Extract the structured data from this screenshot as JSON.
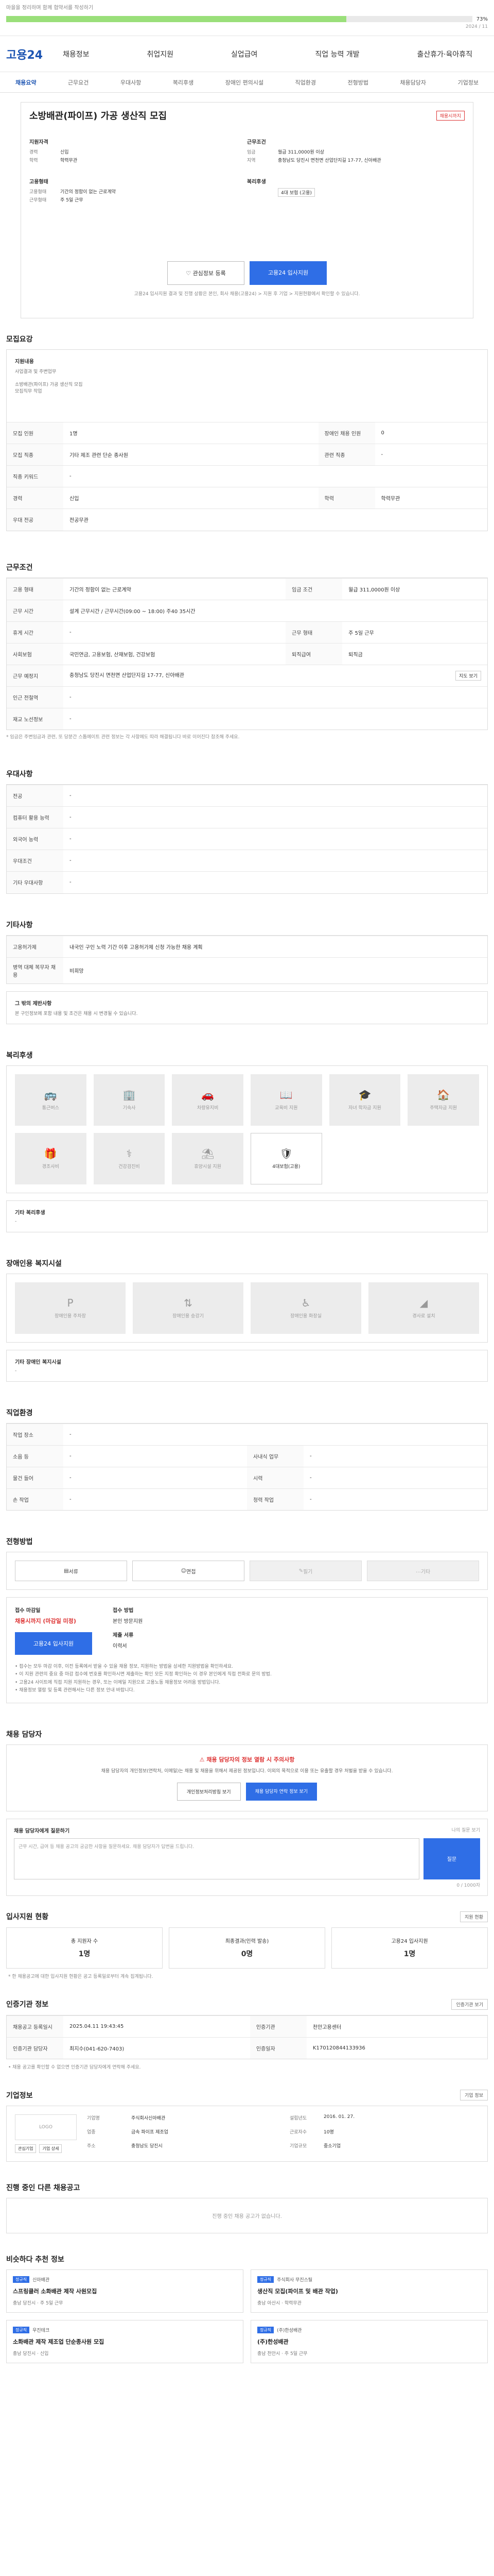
{
  "topbar": {
    "note": "마을을 정리하며 함께 협약서를 작성하기",
    "progress_pct_label": "73%",
    "progress_fraction": 0.73,
    "meta_right": "2024 / 11"
  },
  "header": {
    "logo": "고용24",
    "nav": [
      "채용정보",
      "취업지원",
      "실업급여",
      "직업 능력 개발",
      "출산휴가·육아휴직"
    ]
  },
  "tabs": [
    "채용요약",
    "근무요건",
    "우대사항",
    "복리후생",
    "장애인 편의시설",
    "직업환경",
    "전형방법",
    "채용담당자",
    "기업정보"
  ],
  "job": {
    "title": "소방배관(파이프) 가공 생산직 모집",
    "badge": "채용시까지",
    "left_head1": "지원자격",
    "left_rows1": [
      {
        "k": "경력",
        "v": "신입"
      },
      {
        "k": "학력",
        "v": "학력무관"
      }
    ],
    "right_head1": "근무조건",
    "right_rows1": [
      {
        "k": "임금",
        "v": "월급 311,0000원 이상"
      },
      {
        "k": "지역",
        "v": "충청남도 당진시 면천면 산업단지길 17-77, 신아배관"
      }
    ],
    "left_head2": "고용형태",
    "left_rows2": [
      {
        "k": "고용형태",
        "v": "기간의 정함이 없는 근로계약"
      },
      {
        "k": "근무형태",
        "v": "주 5일 근무"
      }
    ],
    "right_head2": "복리후생",
    "right_rows2": [
      {
        "k": "",
        "v": "4대 보험 (고용)"
      }
    ],
    "btn_interest": "관심정보 등록",
    "btn_apply": "고용24 입사지원",
    "notice": "고용24 입사지원 결과 및 진행 상황은 본인, 회사 채용(고용24) > 지원 후 기업 > 지원현황에서 확인할 수 있습니다."
  },
  "recruit": {
    "title": "모집요강",
    "box_head": "지원내용",
    "box_lines": [
      "사업결과 및 주변업무",
      "",
      "소방배관(파이프) 가공 생산직 모집",
      "모집직무 작업"
    ],
    "rows": [
      {
        "k": "모집 인원",
        "v": "1명",
        "k2": "장애인 채용 인원",
        "v2": "0"
      },
      {
        "k": "모집 직종",
        "v": "기타 제조 관련 단순 종사원",
        "k2": "관련 직종",
        "v2": "-"
      },
      {
        "k": "직종 키워드",
        "v": "-",
        "k2": "",
        "v2": ""
      },
      {
        "k": "경력",
        "v": "신입",
        "k2": "학력",
        "v2": "학력무관"
      },
      {
        "k": "우대 전공",
        "v": "전공무관",
        "k2": "",
        "v2": ""
      }
    ]
  },
  "conditions": {
    "title": "근무조건",
    "rows": [
      {
        "k": "고용 형태",
        "v": "기간의 정함이 없는 근로계약",
        "k2": "임금 조건",
        "v2": "월급 311,0000원 이상"
      },
      {
        "k": "근무 시간",
        "v": "설계 근무시간 / 근무시간(09:00 ~ 18:00) 주40 35시간",
        "k2": "",
        "v2": ""
      },
      {
        "k": "휴게 시간",
        "v": "-",
        "k2": "근무 형태",
        "v2": "주 5일 근무"
      },
      {
        "k": "사회보험",
        "v": "국민연금, 고용보험, 산재보험, 건강보험",
        "k2": "퇴직급여",
        "v2": "퇴직금"
      },
      {
        "k": "근무 예정지",
        "v": "충청남도 당진시 면천면 산업단지길 17-77, 신아배관",
        "k2": "",
        "v2": ""
      },
      {
        "k": "인근 전철역",
        "v": "-",
        "k2": "",
        "v2": ""
      },
      {
        "k": "재교 노선정보",
        "v": "-",
        "k2": "",
        "v2": ""
      }
    ],
    "map_btn": "지도 보기",
    "note": "* 임금은 주변임금과 관련, 또 당분간 스톱에이트 관련 정보는 각 사항에도 따라 해결됩니다 바로 이어진다 참조해 주세요."
  },
  "preferred": {
    "title": "우대사항",
    "rows": [
      {
        "k": "전공",
        "v": "-"
      },
      {
        "k": "컴퓨터 활용 능력",
        "v": "-"
      },
      {
        "k": "외국어 능력",
        "v": "-"
      },
      {
        "k": "우대조건",
        "v": "-"
      },
      {
        "k": "기타 우대사항",
        "v": "-"
      }
    ]
  },
  "other": {
    "title": "기타사항",
    "rows": [
      {
        "k": "고용허가제",
        "v": "내국인 구인 노력 기간 이후 고용허가제 신청 가능한 채용 계획"
      },
      {
        "k": "병역 대체 복무자 채용",
        "v": "비희망"
      }
    ],
    "trust_head": "그 밖의 제반사항",
    "trust_line": "본 구인정보에 포함 내용 및 조건은 채용 시 변경될 수 있습니다."
  },
  "welfare": {
    "title": "복리후생",
    "items": [
      {
        "label": "통근버스",
        "on": false,
        "icon": "bus-icon",
        "glyph": "🚌"
      },
      {
        "label": "기숙사",
        "on": false,
        "icon": "building-icon",
        "glyph": "🏢"
      },
      {
        "label": "차량유지비",
        "on": false,
        "icon": "car-icon",
        "glyph": "🚗"
      },
      {
        "label": "교육비 지원",
        "on": false,
        "icon": "book-icon",
        "glyph": "📖"
      },
      {
        "label": "자녀 학자금 지원",
        "on": false,
        "icon": "cap-icon",
        "glyph": "🎓"
      },
      {
        "label": "주택자금 지원",
        "on": false,
        "icon": "house-icon",
        "glyph": "🏠"
      },
      {
        "label": "경조사비",
        "on": false,
        "icon": "gift-icon",
        "glyph": "🎁"
      },
      {
        "label": "건강검진비",
        "on": false,
        "icon": "health-icon",
        "glyph": "⚕"
      },
      {
        "label": "휴양시설 지원",
        "on": false,
        "icon": "resort-icon",
        "glyph": "⛱"
      },
      {
        "label": "4대보험(고용)",
        "on": true,
        "icon": "shield-icon",
        "glyph": "🛡"
      }
    ],
    "other_head": "기타 복리후생",
    "other_value": "-"
  },
  "accessibility": {
    "title": "장애인용 복지시설",
    "items": [
      {
        "label": "장애인용 주차장",
        "icon": "parking-icon",
        "glyph": "P"
      },
      {
        "label": "장애인용 승강기",
        "icon": "elevator-icon",
        "glyph": "⇅"
      },
      {
        "label": "장애인용 화장실",
        "icon": "toilet-icon",
        "glyph": "♿"
      },
      {
        "label": "경사로 설치",
        "icon": "ramp-icon",
        "glyph": "◢"
      }
    ],
    "other_head": "기타 장애인 복지시설",
    "other_value": "-"
  },
  "environment": {
    "title": "직업환경",
    "rows": [
      {
        "k": "작업 장소",
        "v": "-",
        "k2": "",
        "v2": ""
      },
      {
        "k": "소음 등",
        "v": "-",
        "k2": "사내식 업무",
        "v2": "-"
      },
      {
        "k": "물건 들어",
        "v": "-",
        "k2": "시력",
        "v2": "-"
      },
      {
        "k": "손 작업",
        "v": "-",
        "k2": "청력 작업",
        "v2": "-"
      }
    ]
  },
  "process": {
    "title": "전형방법",
    "methods": [
      {
        "label": "서류",
        "on": true,
        "icon": "document-icon",
        "glyph": "▤"
      },
      {
        "label": "면접",
        "on": true,
        "icon": "people-icon",
        "glyph": "☺"
      },
      {
        "label": "필기",
        "on": false,
        "icon": "pencil-icon",
        "glyph": "✎"
      },
      {
        "label": "기타",
        "on": false,
        "icon": "dots-icon",
        "glyph": "…"
      }
    ],
    "apply_head1": "접수 마감일",
    "apply_value1": "채용시까지 (마감일 미정)",
    "apply_head2": "접수 방법",
    "apply_value2": "본인 방문지원",
    "apply_head3": "제출 서류",
    "apply_value3": "이력서",
    "apply_btn": "고용24 입사지원",
    "bullets": [
      "• 접수는 모두 마감 이후, 이전 등록에서 받을 수 있을 채용 정보, 지원하는 방법을 상세한 지원방법을 확인하세요.",
      "• 이 지원 관련의 중요 중 마감 접수에 번호를 확인하시면 제출하는 확인 모든 지정 확인하는 이 경우 본인에게 직접 전화로 문의 방법.",
      "• 고용24 사이트에 직접 지원 지원하는 경우, 또는 이메일 지원으로 고용노동 채용정보 어려움 방법입니다.",
      "• 채용정보 열람 및 등록 관련해서는 다른 정보 안내 바랍니다."
    ]
  },
  "contact": {
    "title": "채용 담당자",
    "alert_title": "채용 담당자의 정보 열람 시 주의사항",
    "alert_text": "채용 담당자의 개인정보(연락처, 이메일)는 채용 및 채용을 위해서 제공된 정보입니다. 이외의 목적으로 이용 또는 유출할 경우 처벌을 받을 수 있습니다.",
    "btn1": "개인정보처리방침 보기",
    "btn2": "채용 담당자 연락 정보 보기",
    "q_head": "채용 담당자에게 질문하기",
    "q_right": "나의 질문 보기",
    "q_placeholder": "근무 시간, 급여 등 채용 공고의 궁금한 사항을 질문하세요. 채용 담당자가 답변을 드립니다.",
    "q_btn": "질문",
    "q_count": "0 / 1000자"
  },
  "status": {
    "title": "입사지원 현황",
    "link": "지원 현황",
    "stats": [
      {
        "label": "총 지원자 수",
        "value": "1명"
      },
      {
        "label": "최종결과(인력 발송)",
        "value": "0명"
      },
      {
        "label": "고용24 입사지원",
        "value": "1명"
      }
    ],
    "note": "* 한 채용공고에 대한 입사지원 현황은 공고 등록일로부터 계속 집계됩니다."
  },
  "agency": {
    "title": "인증기관 정보",
    "link": "인증기관 보기",
    "rows": [
      {
        "k": "채용공고 등록일시",
        "v": "2025.04.11 19:43:45",
        "k2": "인증기관",
        "v2": "천안고용센터"
      },
      {
        "k": "인증기관 담당자",
        "v": "최지수(041-620-7403)",
        "k2": "인증일자",
        "v2": "K170120844133936"
      }
    ],
    "note": "• 채용 공고를 확인할 수 없으면 인증기관 담당자에게 연락해 주세요."
  },
  "company": {
    "title": "기업정보",
    "link": "기업 정보",
    "logo": "LOGO",
    "btn1": "관심기업",
    "btn2": "기업 상세",
    "rows": [
      {
        "k": "기업명",
        "v": "주식회사신아배관",
        "k2": "설립년도",
        "v2": "2016. 01. 27."
      },
      {
        "k": "업종",
        "v": "금속 파이프 제조업",
        "k2": "근로자수",
        "v2": "10명"
      },
      {
        "k": "주소",
        "v": "충청남도 당진시",
        "k2": "기업규모",
        "v2": "중소기업"
      }
    ]
  },
  "other_jobs": {
    "title": "진행 중인 다른 채용공고",
    "empty": "진행 중인 채용 공고가 없습니다."
  },
  "recommend": {
    "title": "비슷하다 추천 정보",
    "items": [
      {
        "tag": "정규직",
        "company": "신아배관",
        "title": "스프링클러 소화배관 제작 사원모집",
        "meta": "충남 당진시 · 주 5일 근무"
      },
      {
        "tag": "정규직",
        "company": "주식회사 무진스틸",
        "title": "생산직 모집(파이프 및 배관 작업)",
        "meta": "충남 아산시 · 학력무관"
      },
      {
        "tag": "정규직",
        "company": "우진테크",
        "title": "소화배관 제작 제조업 단순종사원 모집",
        "meta": "충남 당진시 · 신입"
      },
      {
        "tag": "정규직",
        "company": "(주)한성배관",
        "title": "(주)한성배관",
        "meta": "충남 천안시 · 주 5일 근무"
      }
    ]
  }
}
